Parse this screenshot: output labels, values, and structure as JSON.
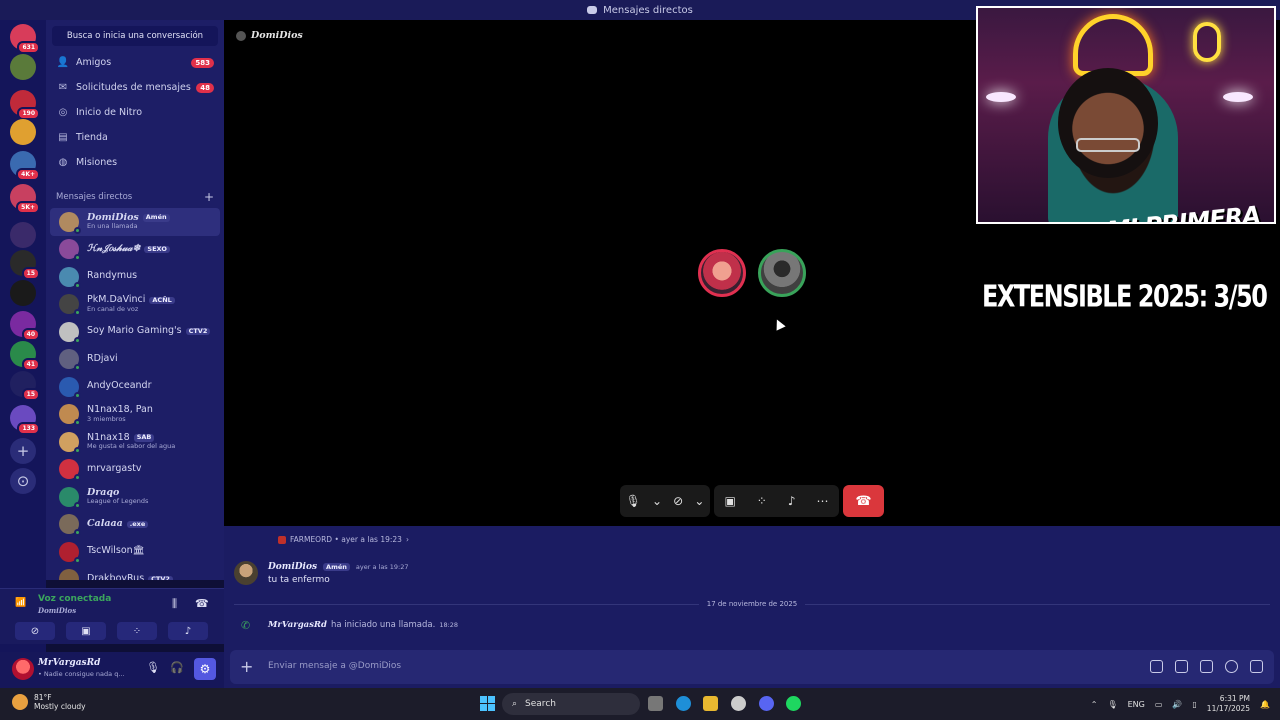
{
  "window": {
    "title": "Mensajes directos"
  },
  "servers": [
    {
      "badge": "631",
      "color": "#d83c5a"
    },
    {
      "badge": "",
      "color": "#5a7a3a"
    },
    {
      "badge": "190",
      "color": "#c02a3a"
    },
    {
      "badge": "",
      "color": "#e0a030"
    },
    {
      "badge": "4K+",
      "color": "#3a6ab0"
    },
    {
      "badge": "5K+",
      "color": "#c84060"
    },
    {
      "badge": "",
      "color": "#3a2a6a"
    },
    {
      "badge": "15",
      "color": "#2a2a2a"
    },
    {
      "badge": "",
      "color": "#1a1a1a"
    },
    {
      "badge": "40",
      "color": "#7a2aa0"
    },
    {
      "badge": "41",
      "color": "#2a8a4a"
    },
    {
      "badge": "15",
      "color": "#202060"
    },
    {
      "badge": "133",
      "color": "#6a4ac0"
    }
  ],
  "sidebar": {
    "search_label": "Busca o inicia una conversación",
    "nav": [
      {
        "label": "Amigos",
        "count": "583",
        "icon": "friends-icon"
      },
      {
        "label": "Solicitudes de mensajes",
        "count": "48",
        "icon": "mail-icon"
      },
      {
        "label": "Inicio de Nitro",
        "count": "",
        "icon": "nitro-icon"
      },
      {
        "label": "Tienda",
        "count": "",
        "icon": "shop-icon"
      },
      {
        "label": "Misiones",
        "count": "",
        "icon": "quests-icon"
      }
    ],
    "dm_header": "Mensajes directos",
    "dms": [
      {
        "name": "DomiDios",
        "tag": "Amén",
        "sub": "En una llamada",
        "color": "#b08a60"
      },
      {
        "name": "ℋ𝓃𝒥𝑜𝓈𝒽𝓊𝒶❄",
        "tag": "SEXO",
        "sub": "",
        "color": "#8a4a9a"
      },
      {
        "name": "Randymus",
        "tag": "",
        "sub": "",
        "color": "#4a8ab0"
      },
      {
        "name": "PkM.DaVinci",
        "tag": "ACÑL",
        "sub": "En canal de voz",
        "color": "#444444"
      },
      {
        "name": "Soy Mario Gaming's",
        "tag": "CTV2",
        "sub": "",
        "color": "#c0c0c0"
      },
      {
        "name": "RDjavi",
        "tag": "",
        "sub": "",
        "color": "#606080"
      },
      {
        "name": "AndyOceandr",
        "tag": "",
        "sub": "",
        "color": "#2a5ab0"
      },
      {
        "name": "N1nax18, Pan",
        "tag": "",
        "sub": "3 miembros",
        "color": "#c08a50"
      },
      {
        "name": "N1nax18",
        "tag": "SAB",
        "sub": "Me gusta el sabor del agua",
        "color": "#d0a060"
      },
      {
        "name": "mrvargastv",
        "tag": "",
        "sub": "",
        "color": "#d03040"
      },
      {
        "name": "Draqo",
        "tag": "",
        "sub": "League of Legends",
        "color": "#2a8a6a"
      },
      {
        "name": "Calaaa",
        "tag": ".exe",
        "sub": "",
        "color": "#7a6a5a"
      },
      {
        "name": "TscWilson🏛",
        "tag": "",
        "sub": "",
        "color": "#b02030"
      },
      {
        "name": "DrakboyRus",
        "tag": "CTV2",
        "sub": "",
        "color": "#806040"
      }
    ]
  },
  "voice": {
    "status": "Voz conectada",
    "channel": "DomiDios"
  },
  "user": {
    "name": "MrVargasRd",
    "status": "• Nadie consigue nada q..."
  },
  "call": {
    "title": "DomiDios"
  },
  "overlay": {
    "logo_text": "MI PRIMERA CASA",
    "counter": "EXTENSIBLE 2025: 3/50"
  },
  "chat": {
    "reply_line": "FARMEORD • ayer a las 19:23",
    "message": {
      "author": "DomiDios",
      "tag": "Amén",
      "time": "ayer a las 19:27",
      "text": "tu ta enfermo"
    },
    "date_separator": "17 de noviembre de 2025",
    "system": {
      "who": "MrVargasRd",
      "text": "ha iniciado una llamada.",
      "time": "18:28"
    },
    "composer_placeholder": "Enviar mensaje a @DomiDios"
  },
  "taskbar": {
    "temp": "81°F",
    "weather": "Mostly cloudy",
    "search": "Search",
    "lang": "ENG",
    "time": "6:31 PM",
    "date": "11/17/2025"
  }
}
